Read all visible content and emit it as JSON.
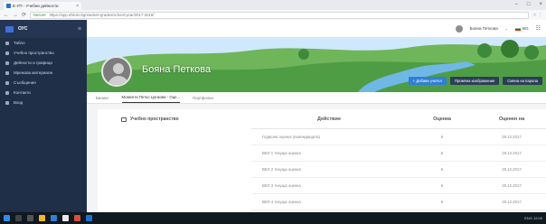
{
  "browser": {
    "tab_title": "Е-УП - Учебни дейности",
    "tab_close": "×",
    "url_security": "Secure",
    "url": "https://app.shkolo.bg/student-grades/school-year/2017-2018/",
    "window_controls": [
      "–",
      "□",
      "×"
    ],
    "nav_glyphs": [
      "←",
      "→",
      "⟳"
    ],
    "addr_right": "☆ ⋮"
  },
  "app": {
    "brand": "ОУС",
    "menu_glyph": "≡"
  },
  "sidebar": {
    "items": [
      {
        "label": "Табло"
      },
      {
        "label": "Учебно пространство"
      },
      {
        "label": "Дейности и графици"
      },
      {
        "label": "Мрежова материали"
      },
      {
        "label": "Съобщения"
      },
      {
        "label": "Контакти"
      },
      {
        "label": "Вход"
      }
    ]
  },
  "topbar": {
    "user_name": "Бояна Петкова",
    "user_chevron": "⌄",
    "language": "BG",
    "apps_glyph": "☷"
  },
  "profile": {
    "name": "Бояна Петкова",
    "buttons": {
      "add_friend": "+ Добави учител",
      "change_image": "Промяна изображение",
      "change_password": "Смяна на парола"
    }
  },
  "profile_tabs": [
    {
      "label": "Биоинс",
      "active": false
    },
    {
      "label": "Моменти Петко Цонкова - Оце...",
      "active": true
    },
    {
      "label": "Портфолио",
      "active": false
    }
  ],
  "grades_table": {
    "workspace_header": "Учебно пространство",
    "columns": {
      "action": "Действие",
      "grade": "Оценка",
      "date": "Оценен на"
    },
    "rows": [
      {
        "action": "Годишна оценка (въвеждащата)",
        "grade": "6",
        "date": "29.12.2017"
      },
      {
        "action": "ВЕЛ 1 текуща оценка",
        "grade": "6",
        "date": "29.12.2017"
      },
      {
        "action": "ВЕЛ 2 текуща оценка",
        "grade": "6",
        "date": "29.12.2017"
      },
      {
        "action": "ВЕЛ 3 текуща оценка",
        "grade": "6",
        "date": "29.12.2017"
      },
      {
        "action": "ВЕЛ 4 текуща оценка",
        "grade": "6",
        "date": "29.12.2017"
      }
    ]
  },
  "taskbar": {
    "tray_text": "ENG  12:00"
  },
  "colors": {
    "sidebar_bg": "#1f2f48",
    "primary_btn": "#2f7fd6",
    "dark_btn": "#2c3e57"
  }
}
